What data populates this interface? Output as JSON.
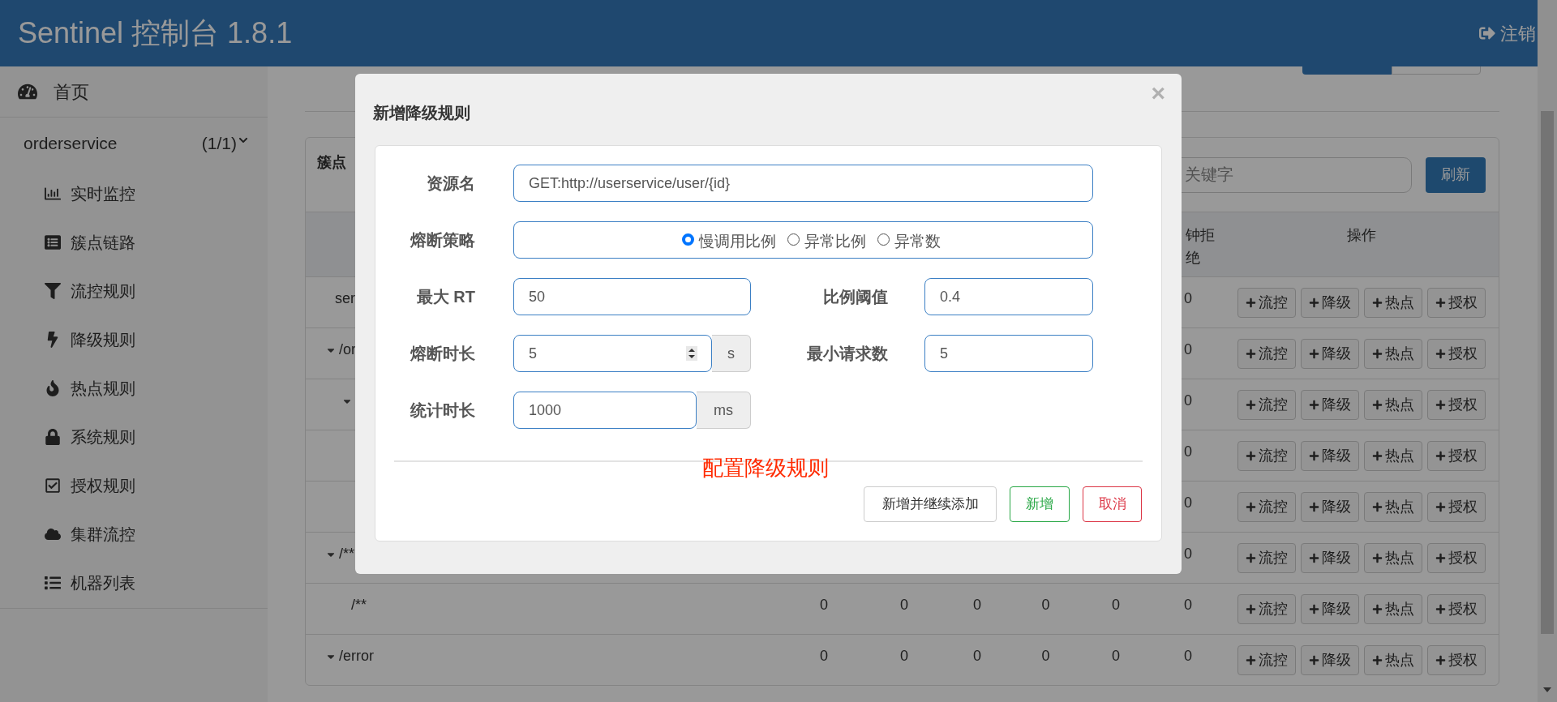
{
  "header": {
    "title": "Sentinel 控制台 1.8.1",
    "logout": "注销"
  },
  "sidebar": {
    "home": "首页",
    "app": {
      "name": "orderservice",
      "count": "(1/1)",
      "expanded": true
    },
    "items": [
      "实时监控",
      "簇点链路",
      "流控规则",
      "降级规则",
      "热点规则",
      "系统规则",
      "授权规则",
      "集群流控",
      "机器列表"
    ]
  },
  "panel": {
    "title": "簇点",
    "search_placeholder": "关键字",
    "refresh": "刷新"
  },
  "table": {
    "columns": [
      "钟拒绝",
      "操作"
    ],
    "rows": [
      {
        "name": "ser",
        "cells": [
          "0"
        ],
        "actions": [
          "流控",
          "降级",
          "热点",
          "授权"
        ]
      },
      {
        "name": "/or",
        "expanded": true,
        "cells": [
          "0"
        ],
        "actions": [
          "流控",
          "降级",
          "热点",
          "授权"
        ],
        "children": [
          {
            "expanded": true,
            "cells": [
              "0"
            ],
            "actions": [
              "流控",
              "降级",
              "热点",
              "授权"
            ],
            "children": [
              {
                "cells": [
                  "0"
                ],
                "actions": [
                  "流控",
                  "降级",
                  "热点",
                  "授权"
                ]
              },
              {
                "cells": [
                  "0"
                ],
                "actions": [
                  "流控",
                  "降级",
                  "热点",
                  "授权"
                ]
              }
            ]
          }
        ]
      },
      {
        "name": "/**",
        "expanded": true,
        "cells": [
          "0"
        ],
        "actions": [
          "流控",
          "降级",
          "热点",
          "授权"
        ],
        "children": [
          {
            "name": "/**",
            "cells": [
              "0",
              "0",
              "0",
              "0",
              "0",
              "0"
            ],
            "actions": [
              "流控",
              "降级",
              "热点",
              "授权"
            ]
          }
        ]
      },
      {
        "name": "/error",
        "expanded": true,
        "cells": [
          "0",
          "0",
          "0",
          "0",
          "0",
          "0"
        ],
        "actions": [
          "流控",
          "降级",
          "热点",
          "授权"
        ]
      }
    ]
  },
  "modal": {
    "title": "新增降级规则",
    "close": "×",
    "resource": {
      "label": "资源名",
      "value": "GET:http://userservice/user/{id}"
    },
    "strategy": {
      "label": "熔断策略",
      "options": [
        {
          "label": "慢调用比例",
          "selected": true
        },
        {
          "label": "异常比例",
          "selected": false
        },
        {
          "label": "异常数",
          "selected": false
        }
      ]
    },
    "max_rt": {
      "label": "最大 RT",
      "value": "50"
    },
    "ratio": {
      "label": "比例阈值",
      "value": "0.4"
    },
    "duration": {
      "label": "熔断时长",
      "value": "5",
      "unit": "s"
    },
    "min_requests": {
      "label": "最小请求数",
      "value": "5"
    },
    "stat_duration": {
      "label": "统计时长",
      "value": "1000",
      "unit": "ms"
    },
    "annotation": "配置降级规则",
    "buttons": [
      {
        "label": "新增并继续添加",
        "kind": "default"
      },
      {
        "label": "新增",
        "kind": "success"
      },
      {
        "label": "取消",
        "kind": "danger"
      }
    ]
  }
}
